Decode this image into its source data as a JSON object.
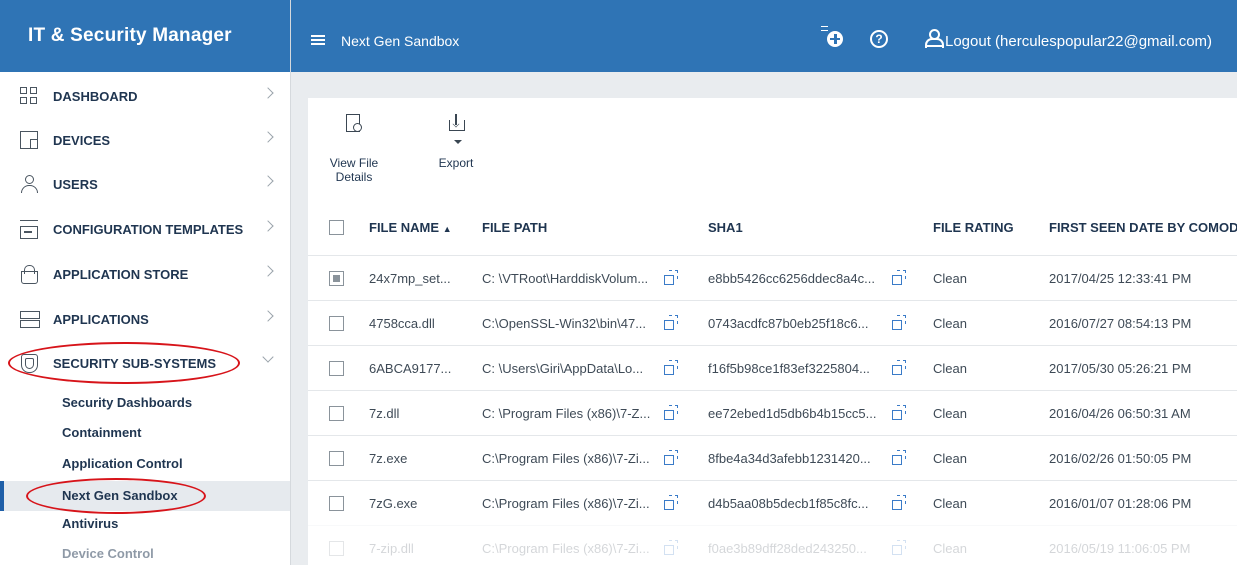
{
  "app": {
    "brand": "IT & Security Manager"
  },
  "header": {
    "page_title": "Next Gen Sandbox",
    "help_glyph": "?",
    "logout": "Logout (herculespopular22@gmail.com)"
  },
  "sidebar": {
    "items": [
      {
        "label": "DASHBOARD",
        "icon": "dashboard-icon"
      },
      {
        "label": "DEVICES",
        "icon": "devices-icon"
      },
      {
        "label": "USERS",
        "icon": "users-icon"
      },
      {
        "label": "CONFIGURATION TEMPLATES",
        "icon": "configuration-templates-icon"
      },
      {
        "label": "APPLICATION STORE",
        "icon": "application-store-icon"
      },
      {
        "label": "APPLICATIONS",
        "icon": "applications-icon"
      },
      {
        "label": "SECURITY SUB-SYSTEMS",
        "icon": "shield-icon"
      }
    ],
    "sub_items": [
      "Security Dashboards",
      "Containment",
      "Application Control",
      "Next Gen Sandbox",
      "Antivirus",
      "Device Control"
    ]
  },
  "toolbar": {
    "view_file_details": "View File Details",
    "export": "Export"
  },
  "table": {
    "columns": [
      "FILE NAME",
      "FILE PATH",
      "SHA1",
      "FILE RATING",
      "FIRST SEEN DATE BY COMODO"
    ],
    "sort_indicator": "▲",
    "rows": [
      {
        "file_name": "24x7mp_set...",
        "file_path": "C: \\VTRoot\\HarddiskVolum...",
        "sha1": "e8bb5426cc6256ddec8a4c...",
        "rating": "Clean",
        "first_seen": "2017/04/25 12:33:41 PM",
        "checked": true
      },
      {
        "file_name": "4758cca.dll",
        "file_path": "C:\\OpenSSL-Win32\\bin\\47...",
        "sha1": "0743acdfc87b0eb25f18c6...",
        "rating": "Clean",
        "first_seen": "2016/07/27 08:54:13 PM",
        "checked": false
      },
      {
        "file_name": "6ABCA9177...",
        "file_path": "C: \\Users\\Giri\\AppData\\Lo...",
        "sha1": "f16f5b98ce1f83ef3225804...",
        "rating": "Clean",
        "first_seen": "2017/05/30 05:26:21 PM",
        "checked": false
      },
      {
        "file_name": "7z.dll",
        "file_path": "C: \\Program Files (x86)\\7-Z...",
        "sha1": "ee72ebed1d5db6b4b15cc5...",
        "rating": "Clean",
        "first_seen": "2016/04/26 06:50:31 AM",
        "checked": false
      },
      {
        "file_name": "7z.exe",
        "file_path": "C:\\Program Files (x86)\\7-Zi...",
        "sha1": "8fbe4a34d3afebb1231420...",
        "rating": "Clean",
        "first_seen": "2016/02/26 01:50:05 PM",
        "checked": false
      },
      {
        "file_name": "7zG.exe",
        "file_path": "C:\\Program Files (x86)\\7-Zi...",
        "sha1": "d4b5aa08b5decb1f85c8fc...",
        "rating": "Clean",
        "first_seen": "2016/01/07 01:28:06 PM",
        "checked": false
      },
      {
        "file_name": "7-zip.dll",
        "file_path": "C:\\Program Files (x86)\\7-Zi...",
        "sha1": "f0ae3b89dff28ded243250...",
        "rating": "Clean",
        "first_seen": "2016/05/19 11:06:05 PM",
        "checked": false
      }
    ]
  },
  "colors": {
    "brand_blue": "#2f74b5",
    "annotation_red": "#d7141a",
    "link_blue": "#3a7bc8"
  }
}
